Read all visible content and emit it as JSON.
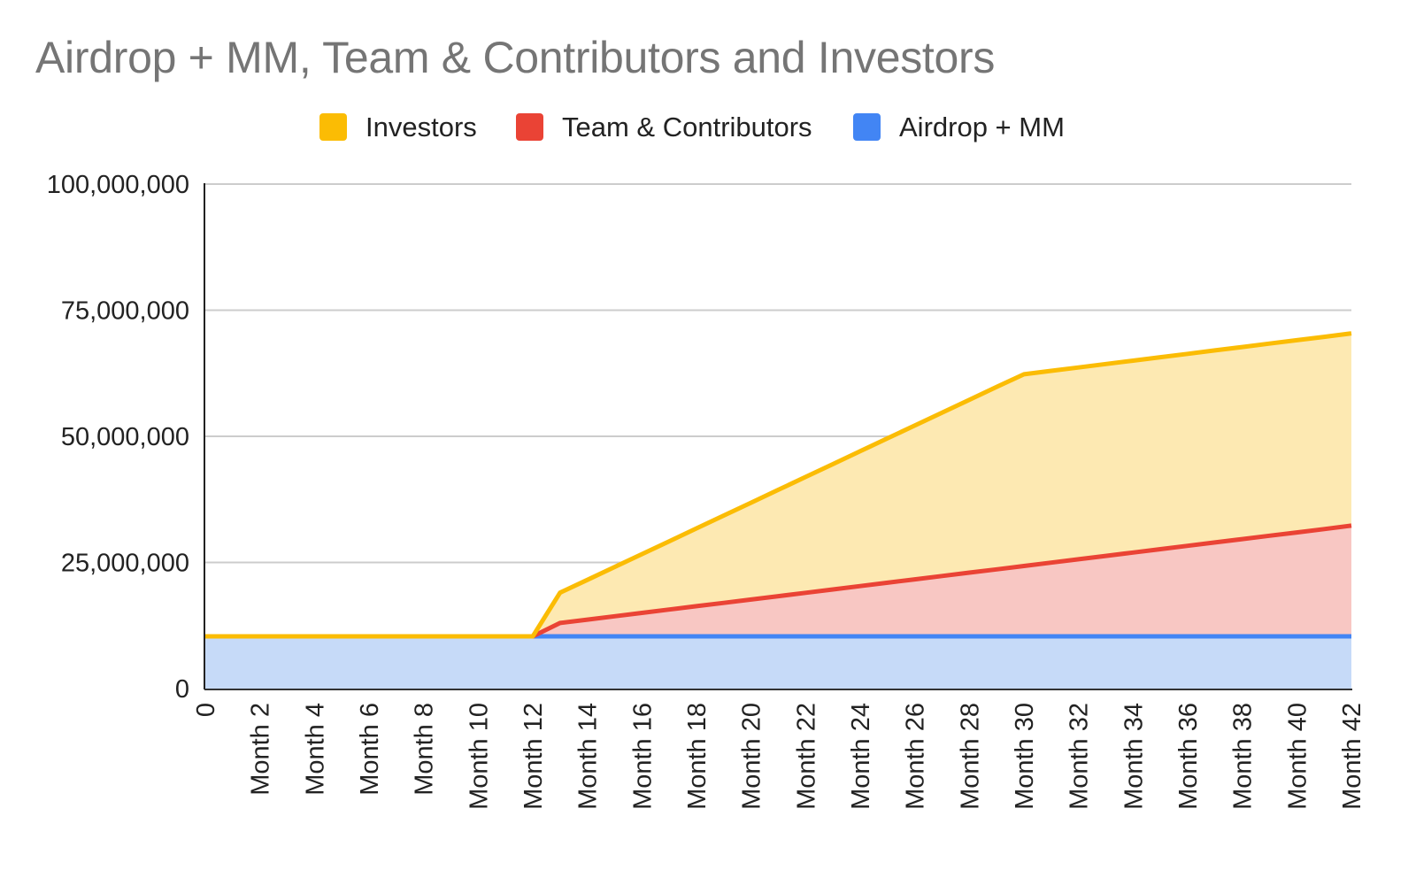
{
  "chart_data": {
    "type": "area",
    "stacked": true,
    "title": "Airdrop + MM, Team & Contributors and Investors",
    "xlabel": "",
    "ylabel": "",
    "ylim": [
      0,
      100000000
    ],
    "yticks": [
      0,
      25000000,
      50000000,
      75000000,
      100000000
    ],
    "ytick_labels": [
      "0",
      "25,000,000",
      "50,000,000",
      "75,000,000",
      "100,000,000"
    ],
    "grid": true,
    "legend_position": "top",
    "x": [
      "0",
      "Month 1",
      "Month 2",
      "Month 3",
      "Month 4",
      "Month 5",
      "Month 6",
      "Month 7",
      "Month 8",
      "Month 9",
      "Month 10",
      "Month 11",
      "Month 12",
      "Month 13",
      "Month 14",
      "Month 15",
      "Month 16",
      "Month 17",
      "Month 18",
      "Month 19",
      "Month 20",
      "Month 21",
      "Month 22",
      "Month 23",
      "Month 24",
      "Month 25",
      "Month 26",
      "Month 27",
      "Month 28",
      "Month 29",
      "Month 30",
      "Month 31",
      "Month 32",
      "Month 33",
      "Month 34",
      "Month 35",
      "Month 36",
      "Month 37",
      "Month 38",
      "Month 39",
      "Month 40",
      "Month 41",
      "Month 42"
    ],
    "xtick_labels": [
      "0",
      "Month 2",
      "Month 4",
      "Month 6",
      "Month 8",
      "Month 10",
      "Month 12",
      "Month 14",
      "Month 16",
      "Month 18",
      "Month 20",
      "Month 22",
      "Month 24",
      "Month 26",
      "Month 28",
      "Month 30",
      "Month 32",
      "Month 34",
      "Month 36",
      "Month 38",
      "Month 40",
      "Month 42"
    ],
    "series": [
      {
        "name": "Airdrop + MM",
        "color": "#4285f4",
        "fill": "#c6daf8",
        "values": [
          10350000,
          10350000,
          10350000,
          10350000,
          10350000,
          10350000,
          10350000,
          10350000,
          10350000,
          10350000,
          10350000,
          10350000,
          10350000,
          10350000,
          10350000,
          10350000,
          10350000,
          10350000,
          10350000,
          10350000,
          10350000,
          10350000,
          10350000,
          10350000,
          10350000,
          10350000,
          10350000,
          10350000,
          10350000,
          10350000,
          10350000,
          10350000,
          10350000,
          10350000,
          10350000,
          10350000,
          10350000,
          10350000,
          10350000,
          10350000,
          10350000,
          10350000,
          10350000
        ]
      },
      {
        "name": "Team & Contributors",
        "color": "#ea4335",
        "fill": "#f8c7c3",
        "values": [
          0,
          0,
          0,
          0,
          0,
          0,
          0,
          0,
          0,
          0,
          0,
          0,
          0,
          2650000,
          3315000,
          3980000,
          4645000,
          5310000,
          5975000,
          6640000,
          7305000,
          7970000,
          8635000,
          9300000,
          9965000,
          10630000,
          11295000,
          11960000,
          12625000,
          13290000,
          13955000,
          14620000,
          15285000,
          15950000,
          16615000,
          17280000,
          17945000,
          18610000,
          19275000,
          19940000,
          20605000,
          21270000,
          21950000
        ]
      },
      {
        "name": "Investors",
        "color": "#fbbc04",
        "fill": "#fde9b2",
        "values": [
          0,
          0,
          0,
          0,
          0,
          0,
          0,
          0,
          0,
          0,
          0,
          0,
          0,
          6000000,
          7885000,
          9770000,
          11655000,
          13540000,
          15425000,
          17310000,
          19195000,
          21080000,
          22965000,
          24850000,
          26735000,
          28620000,
          30505000,
          32390000,
          34275000,
          36160000,
          38000000,
          38010000,
          38020000,
          38030000,
          38040000,
          38050000,
          38060000,
          38070000,
          38080000,
          38090000,
          38100000,
          38100000,
          38100000
        ]
      }
    ]
  },
  "legend": [
    {
      "label": "Investors",
      "color": "#fbbc04"
    },
    {
      "label": "Team & Contributors",
      "color": "#ea4335"
    },
    {
      "label": "Airdrop + MM",
      "color": "#4285f4"
    }
  ]
}
